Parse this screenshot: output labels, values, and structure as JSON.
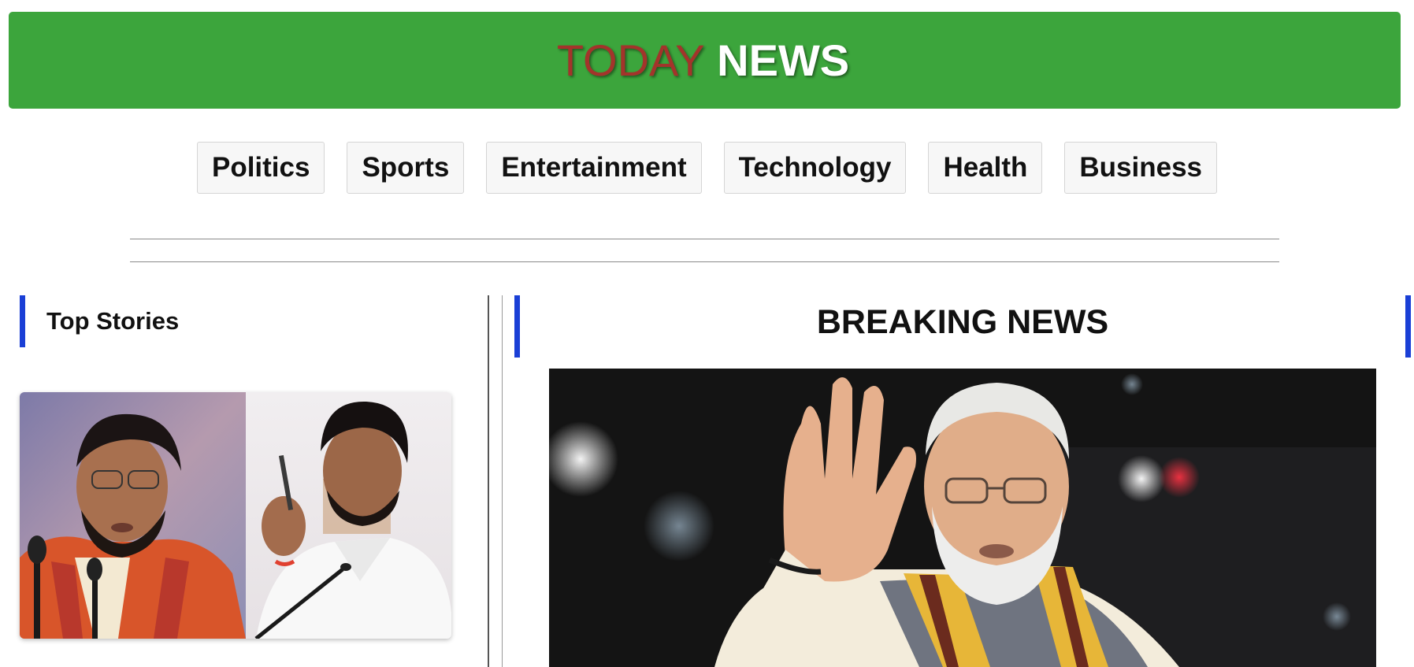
{
  "header": {
    "logo_part1": "TODAY",
    "logo_part2": "NEWS",
    "background_color": "#3ca53c",
    "logo_part1_color": "#a3342b",
    "logo_part2_color": "#ffffff"
  },
  "nav": {
    "items": [
      {
        "label": "Politics"
      },
      {
        "label": "Sports"
      },
      {
        "label": "Entertainment"
      },
      {
        "label": "Technology"
      },
      {
        "label": "Health"
      },
      {
        "label": "Business"
      }
    ]
  },
  "top_stories": {
    "title": "Top Stories",
    "accent_color": "#1a3fd6"
  },
  "breaking": {
    "title": "BREAKING NEWS",
    "accent_color": "#1a3fd6"
  }
}
